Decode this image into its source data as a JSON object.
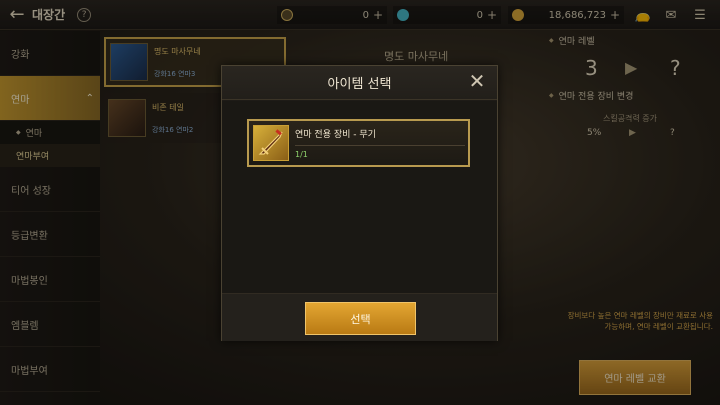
{
  "header": {
    "title": "대장간",
    "help": "?"
  },
  "currencies": [
    {
      "icon": "moon-coin-icon",
      "value": "0",
      "color": "#d1b15e"
    },
    {
      "icon": "gem-icon",
      "value": "0",
      "color": "#47b7c7"
    },
    {
      "icon": "gold-icon",
      "value": "18,686,723",
      "color": "#d8a63a"
    }
  ],
  "sidebar": {
    "items": [
      "강화",
      "연마",
      "티어 성장",
      "등급변환",
      "마법봉인",
      "엠블렘",
      "마법부여"
    ],
    "subitems": [
      "연마",
      "연마부여"
    ]
  },
  "list": [
    {
      "name": "명도 마사무네",
      "sub": "강화16 연마3"
    },
    {
      "name": "비존 테일",
      "sub": "강화16 연마2"
    }
  ],
  "bg": {
    "item_title": "명도 마사무네"
  },
  "right": {
    "level_label": "연마 레벨",
    "level_from": "3",
    "arrow": "▶",
    "level_to": "?",
    "change_label": "연마 전용 장비 변경",
    "stat_label": "스킬공격력 증가",
    "stat_from": "5%",
    "stat_to": "?",
    "notice": "장비보다 높은 연마 레벨의 장비만 재료로 사용 가능하며, 연마 레벨이 교환됩니다."
  },
  "exchange_button": "연마 레벨 교환",
  "modal": {
    "title": "아이템 선택",
    "close": "✕",
    "item_name": "연마 전용 장비 - 무기",
    "item_count": "1/1",
    "select_button": "선택"
  }
}
